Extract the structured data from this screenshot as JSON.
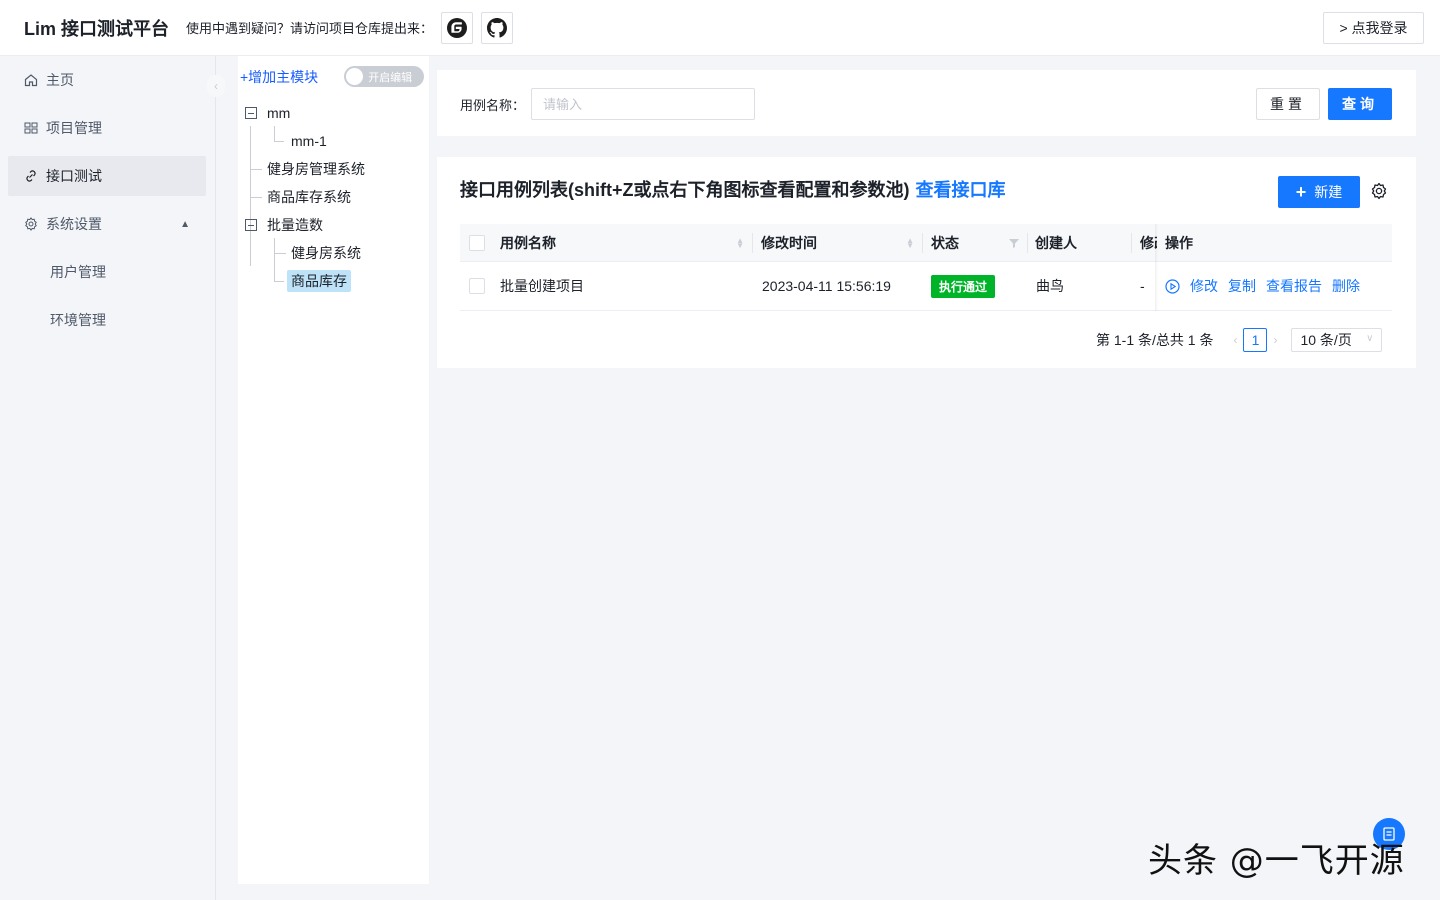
{
  "header": {
    "title": "Lim 接口测试平台",
    "help_text": "使用中遇到疑问？请访问项目仓库提出来：",
    "gitee_icon": "gitee-icon",
    "github_icon": "github-icon",
    "login_label": "> 点我登录"
  },
  "sidebar": {
    "items": [
      {
        "label": "主页",
        "icon": "home-icon"
      },
      {
        "label": "项目管理",
        "icon": "grid-icon"
      },
      {
        "label": "接口测试",
        "icon": "link-icon",
        "active": true
      },
      {
        "label": "系统设置",
        "icon": "gear-icon",
        "expanded": true
      },
      {
        "label": "用户管理"
      },
      {
        "label": "环境管理"
      }
    ]
  },
  "tree": {
    "add_module_label": "+增加主模块",
    "edit_switch_label": "开启编辑",
    "nodes": [
      {
        "label": "mm",
        "level": 0,
        "expanded": true
      },
      {
        "label": "mm-1",
        "level": 1
      },
      {
        "label": "健身房管理系统",
        "level": 0
      },
      {
        "label": "商品库存系统",
        "level": 0
      },
      {
        "label": "批量造数",
        "level": 0,
        "expanded": true
      },
      {
        "label": "健身房系统",
        "level": 1
      },
      {
        "label": "商品库存",
        "level": 1,
        "selected": true
      }
    ]
  },
  "search": {
    "label": "用例名称：",
    "placeholder": "请输入",
    "value": "",
    "reset_label": "重置",
    "query_label": "查询"
  },
  "table": {
    "title": "接口用例列表(shift+Z或点右下角图标查看配置和参数池)",
    "library_link": "查看接口库",
    "new_label": "新建",
    "columns": [
      "用例名称",
      "修改时间",
      "状态",
      "创建人",
      "修改人",
      "操作"
    ],
    "rows": [
      {
        "name": "批量创建项目",
        "modified": "2023-04-11 15:56:19",
        "status": "执行通过",
        "creator": "曲鸟",
        "modifier": "-",
        "actions": [
          "修改",
          "复制",
          "查看报告",
          "删除"
        ]
      }
    ],
    "pagination": {
      "summary": "第 1-1 条/总共 1 条",
      "current_page": "1",
      "page_size": "10 条/页"
    }
  },
  "colors": {
    "primary": "#1677ff",
    "success": "#00b42a",
    "selected_tree": "#bee3f8"
  },
  "watermark": "头条 @一飞开源"
}
